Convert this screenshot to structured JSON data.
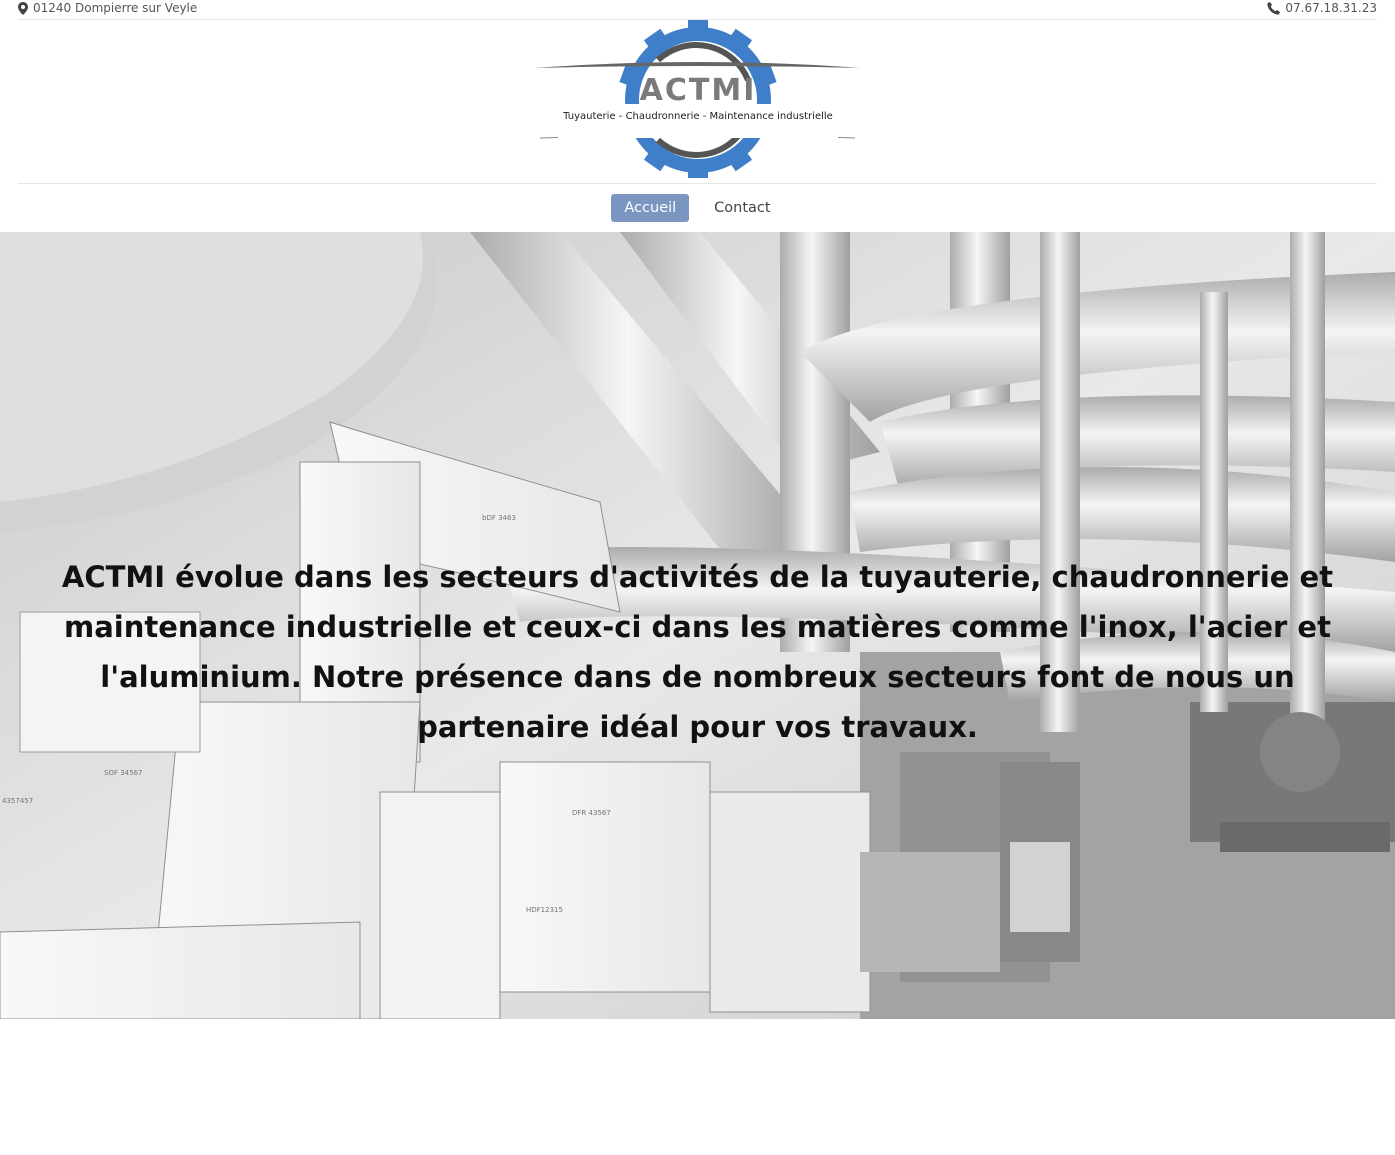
{
  "topbar": {
    "address": "01240 Dompierre sur Veyle",
    "phone": "07.67.18.31.23",
    "address_icon": "map-marker-icon",
    "phone_icon": "phone-icon"
  },
  "logo": {
    "name": "ACTMI",
    "tagline": "Tuyauterie - Chaudronnerie - Maintenance industrielle",
    "gear_color": "#3f7fc9"
  },
  "nav": {
    "items": [
      {
        "label": "Accueil",
        "active": true
      },
      {
        "label": "Contact",
        "active": false
      }
    ],
    "active_color": "#7b97c1"
  },
  "hero": {
    "text": "ACTMI évolue dans les secteurs d'activités de la tuyauterie, chaudronnerie et maintenance industrielle et ceux-ci dans les matières comme l'inox, l'acier et l'aluminium. Notre présence dans de nombreux secteurs font de nous un partenaire idéal pour vos travaux.",
    "drawing_labels": [
      "bDF 3463",
      "SOF 34567",
      "4357457",
      "DFR 43567",
      "HDF12315"
    ]
  }
}
